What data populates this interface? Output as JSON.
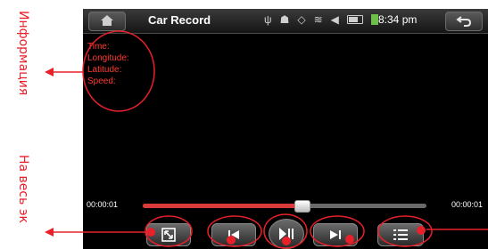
{
  "annotations": {
    "info_label": "Информация",
    "fullscreen_label": "На весь эк"
  },
  "topbar": {
    "title": "Car Record",
    "clock": "8:34 pm"
  },
  "info": {
    "time_label": "Time:",
    "longitude_label": "Longitude:",
    "latitude_label": "Latitude:",
    "speed_label": "Speed:"
  },
  "seekbar": {
    "elapsed": "00:00:01",
    "duration": "00:00:01",
    "progress_fraction": 0.56
  },
  "icons": {
    "home": "home-icon",
    "back": "back-arrow-icon",
    "usb": "usb-icon",
    "android": "android-icon",
    "gps": "gps-icon",
    "wifi": "wifi-icon",
    "volume": "volume-icon",
    "battery": "battery-icon",
    "charging": "charging-icon"
  },
  "colors": {
    "annotation_red": "#e8202a",
    "info_text": "#ff3b30",
    "progress_red": "#d83a3a"
  }
}
